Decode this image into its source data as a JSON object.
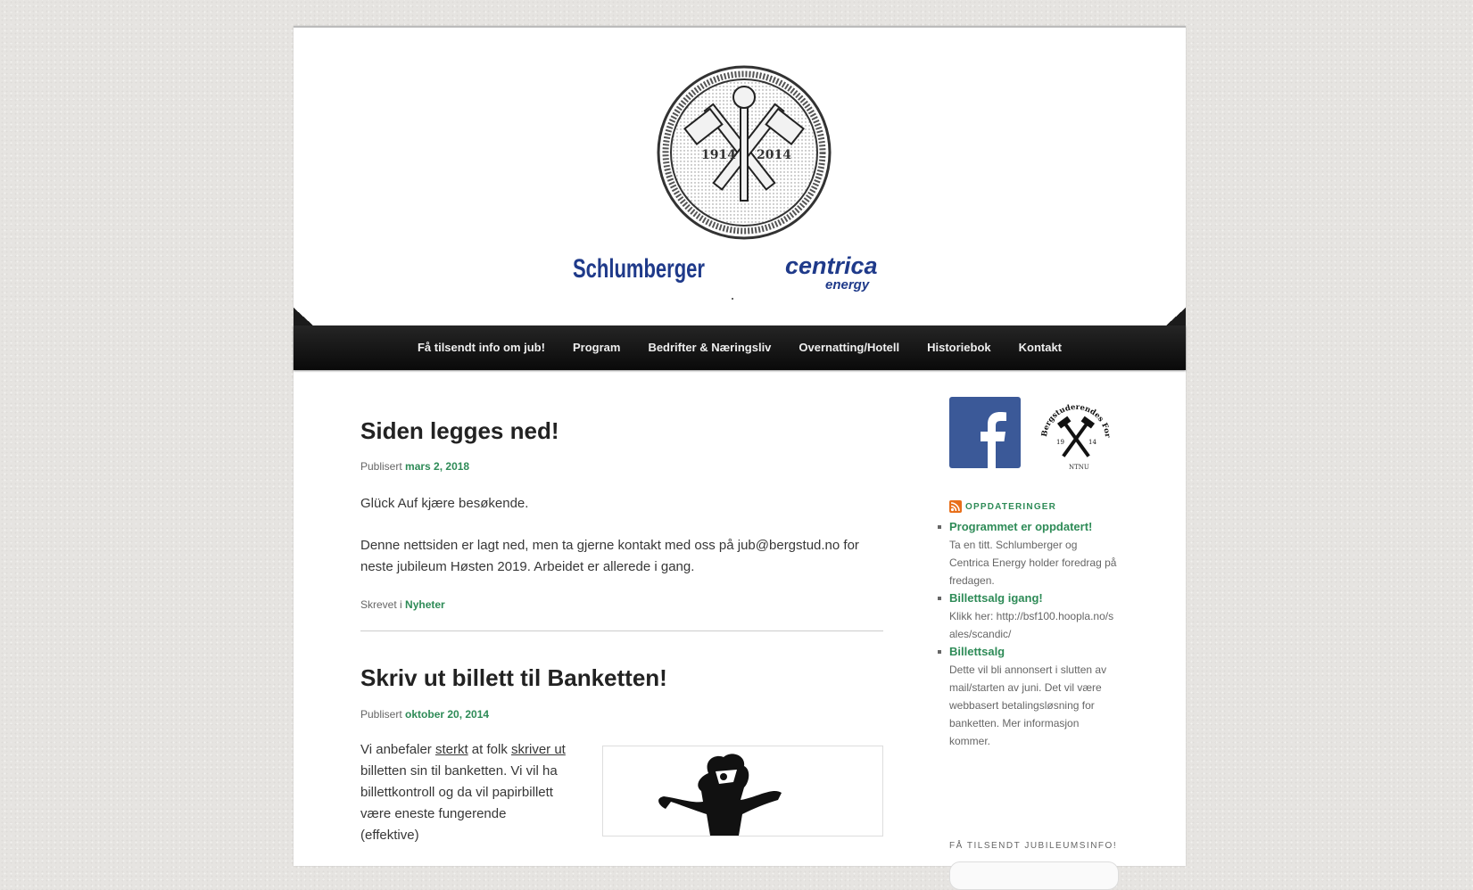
{
  "header": {
    "seal_year_left": "1914",
    "seal_year_right": "2014",
    "sponsor_left": "Schlumberger",
    "sponsor_right_main": "centrica",
    "sponsor_right_sub": "energy"
  },
  "nav": {
    "items": [
      {
        "label": "Få tilsendt info om jub!"
      },
      {
        "label": "Program"
      },
      {
        "label": "Bedrifter & Næringsliv"
      },
      {
        "label": "Overnatting/Hotell"
      },
      {
        "label": "Historiebok"
      },
      {
        "label": "Kontakt"
      }
    ]
  },
  "posts": [
    {
      "title": "Siden legges ned!",
      "published_prefix": "Publisert",
      "date": "mars 2, 2018",
      "paragraphs": [
        "Glück Auf kjære besøkende.",
        "Denne nettsiden er lagt ned, men ta gjerne kontakt med oss på jub@bergstud.no for neste jubileum Høsten 2019. Arbeidet er allerede i gang."
      ],
      "footer_prefix": "Skrevet i",
      "category": "Nyheter"
    },
    {
      "title": "Skriv ut billett til Banketten!",
      "published_prefix": "Publisert",
      "date": "oktober 20, 2014",
      "body_parts": {
        "p1": "Vi anbefaler ",
        "link1": "sterkt",
        "p2": " at folk ",
        "link2": "skriver ut",
        "p3": " billetten sin til banketten. Vi vil ha billettkontroll og da vil papirbillett være eneste fungerende (effektive)"
      }
    }
  ],
  "sidebar": {
    "badge_text_top": "Bergstuderendes Forening",
    "badge_year_left": "19",
    "badge_year_right": "14",
    "badge_text_bottom": "NTNU",
    "rss_title": "OPPDATERINGER",
    "rss_items": [
      {
        "title": "Programmet er oppdatert!",
        "summary": "Ta en titt. Schlumberger og Centrica Energy holder foredrag på fredagen."
      },
      {
        "title": "Billettsalg igang!",
        "summary": "Klikk her: http://bsf100.hoopla.no/sales/scandic/"
      },
      {
        "title": "Billettsalg",
        "summary": "Dette vil bli annonsert i slutten av mail/starten av juni. Det vil være webbasert betalingsløsning for banketten. Mer informasjon kommer."
      }
    ],
    "signup_title": "FÅ TILSENDT JUBILEUMSINFO!"
  },
  "colors": {
    "link_green": "#2e8b57",
    "nav_bg": "#111111",
    "facebook_blue": "#3b5998",
    "rss_orange": "#e86f1a"
  }
}
